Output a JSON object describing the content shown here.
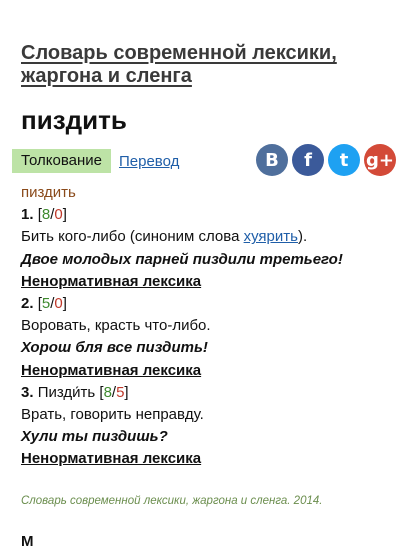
{
  "dictionary_title": "Словарь современной лексики, жаргона и сленга",
  "headword": "пиздить",
  "tabs": {
    "active": "Толкование",
    "link": "Перевод"
  },
  "share": {
    "vk": "В",
    "facebook": "f",
    "twitter": "t",
    "googleplus": "g+"
  },
  "entry": {
    "word": "пиздить",
    "senses": [
      {
        "number": "1.",
        "votes_up": "8",
        "votes_down": "0",
        "definition_before": "Бить кого-либо (синоним слова ",
        "definition_link": "хуярить",
        "definition_after": ").",
        "example": "Двое молодых парней пиздили третьего!",
        "category": "Ненормативная лексика"
      },
      {
        "number": "2.",
        "votes_up": "5",
        "votes_down": "0",
        "definition": "Воровать, красть что-либо.",
        "example": "Хорош бля все пиздить!",
        "category": "Ненормативная лексика"
      },
      {
        "number": "3.",
        "form": "Пизди́ть",
        "votes_up": "8",
        "votes_down": "5",
        "definition": "Врать, говорить неправду.",
        "example": "Хули ты пиздишь?",
        "category": "Ненормативная лексика"
      }
    ]
  },
  "source": "Словарь современной лексики, жаргона и сленга. 2014.",
  "next_partial": "М"
}
